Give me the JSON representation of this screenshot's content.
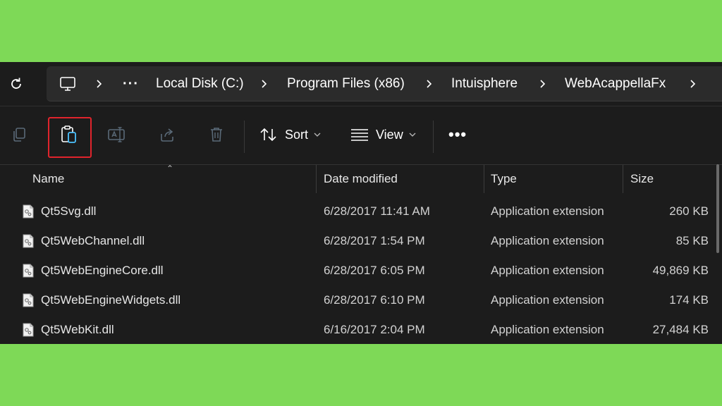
{
  "address_bar": {
    "breadcrumbs": [
      "Local Disk (C:)",
      "Program Files (x86)",
      "Intuisphere",
      "WebAcappellaFx"
    ],
    "overflow_label": "···"
  },
  "toolbar": {
    "sort_label": "Sort",
    "view_label": "View",
    "more_label": "•••"
  },
  "columns": {
    "name": "Name",
    "date": "Date modified",
    "type": "Type",
    "size": "Size"
  },
  "files": [
    {
      "name": "Qt5Svg.dll",
      "date": "6/28/2017 11:41 AM",
      "type": "Application extension",
      "size": "260 KB"
    },
    {
      "name": "Qt5WebChannel.dll",
      "date": "6/28/2017 1:54 PM",
      "type": "Application extension",
      "size": "85 KB"
    },
    {
      "name": "Qt5WebEngineCore.dll",
      "date": "6/28/2017 6:05 PM",
      "type": "Application extension",
      "size": "49,869 KB"
    },
    {
      "name": "Qt5WebEngineWidgets.dll",
      "date": "6/28/2017 6:10 PM",
      "type": "Application extension",
      "size": "174 KB"
    },
    {
      "name": "Qt5WebKit.dll",
      "date": "6/16/2017 2:04 PM",
      "type": "Application extension",
      "size": "27,484 KB"
    }
  ],
  "colors": {
    "background": "#7ed957",
    "window": "#1c1c1c",
    "highlight": "#e0242c"
  }
}
